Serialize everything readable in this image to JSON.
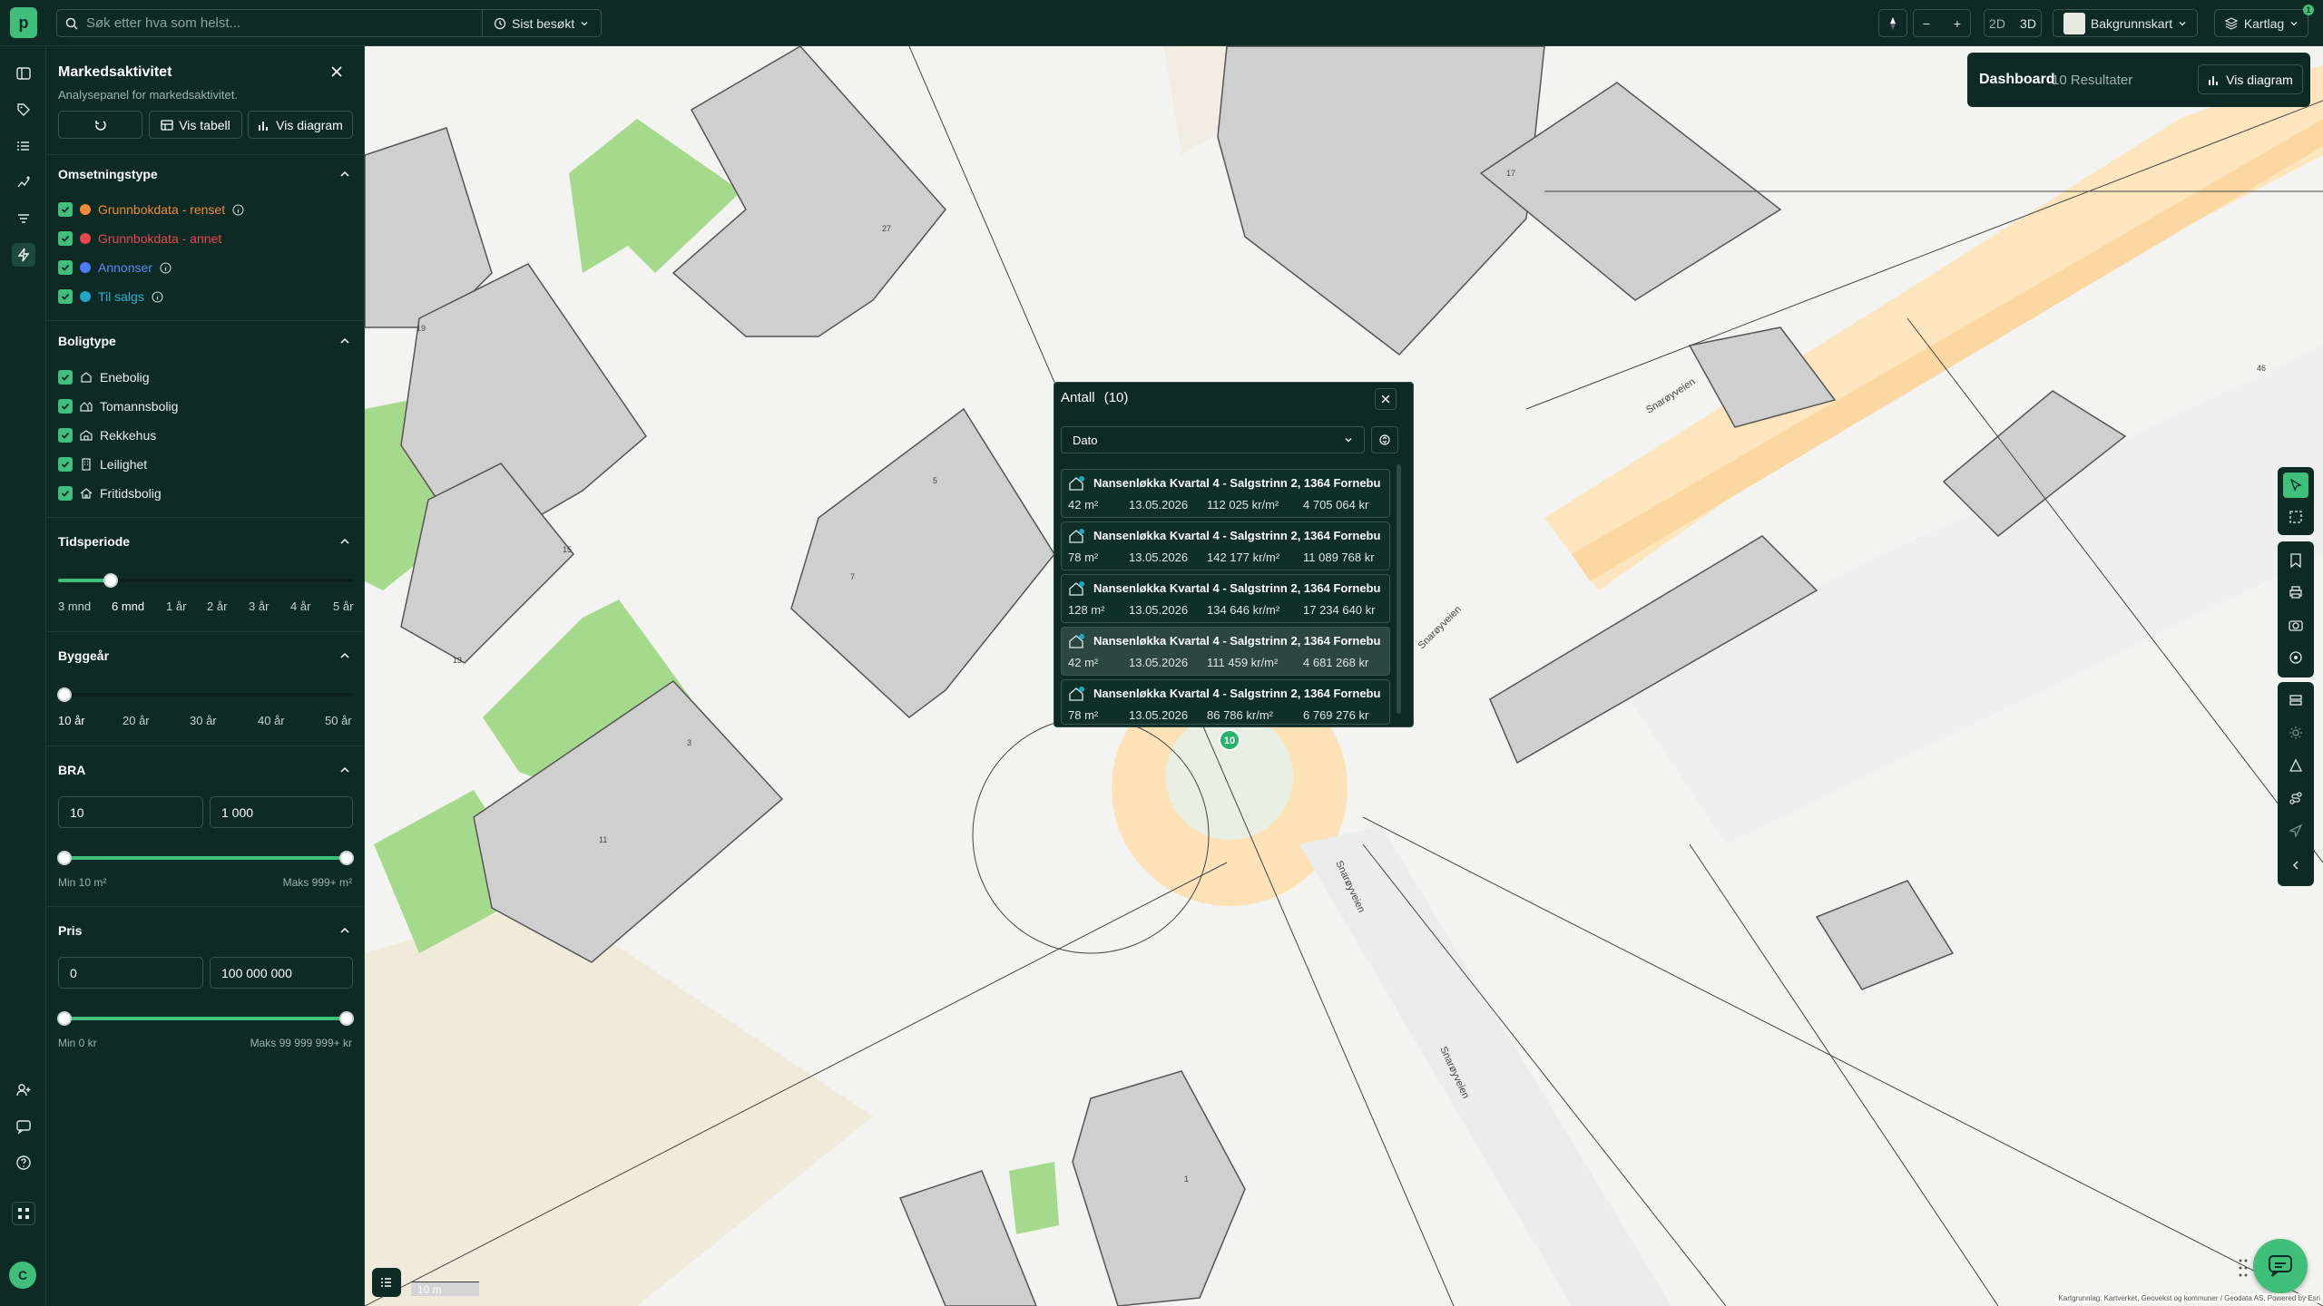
{
  "topbar": {
    "logo_letter": "p",
    "search_placeholder": "Søk etter hva som helst...",
    "recent_label": "Sist besøkt",
    "view_2d": "2D",
    "view_3d": "3D",
    "basemap_label": "Bakgrunnskart",
    "layers_label": "Kartlag",
    "layers_badge": "1"
  },
  "rail": {
    "avatar_letter": "C"
  },
  "panel": {
    "title": "Markedsaktivitet",
    "subtitle": "Analysepanel for markedsaktivitet.",
    "table_button": "Vis tabell",
    "chart_button": "Vis diagram",
    "transaction_type": {
      "title": "Omsetningstype",
      "items": [
        {
          "label": "Grunnbokdata - renset",
          "color": "#f08a3c",
          "checked": true,
          "info": true
        },
        {
          "label": "Grunnbokdata - annet",
          "color": "#e5484d",
          "checked": true,
          "info": false
        },
        {
          "label": "Annonser",
          "color": "#4f7cf0",
          "checked": true,
          "info": true
        },
        {
          "label": "Til salgs",
          "color": "#1fa6c9",
          "checked": true,
          "info": true
        }
      ]
    },
    "housing_type": {
      "title": "Boligtype",
      "items": [
        {
          "label": "Enebolig",
          "checked": true
        },
        {
          "label": "Tomannsbolig",
          "checked": true
        },
        {
          "label": "Rekkehus",
          "checked": true
        },
        {
          "label": "Leilighet",
          "checked": true
        },
        {
          "label": "Fritidsbolig",
          "checked": true
        }
      ]
    },
    "period": {
      "title": "Tidsperiode",
      "ticks": [
        "3 mnd",
        "6 mnd",
        "1 år",
        "2 år",
        "3 år",
        "4 år",
        "5 år"
      ],
      "selected": "6 mnd"
    },
    "build_year": {
      "title": "Byggeår",
      "ticks": [
        "10 år",
        "20 år",
        "30 år",
        "40 år",
        "50 år"
      ],
      "selected": "10 år"
    },
    "bra": {
      "title": "BRA",
      "min_value": "10",
      "max_value": "1 000",
      "min_label": "Min 10 m²",
      "max_label": "Maks 999+ m²"
    },
    "price": {
      "title": "Pris",
      "min_value": "0",
      "max_value": "100 000 000",
      "min_label": "Min 0 kr",
      "max_label": "Maks 99 999 999+ kr"
    }
  },
  "popup": {
    "title": "Antall",
    "count": "(10)",
    "sort_label": "Dato",
    "rows": [
      {
        "title": "Nansenløkka Kvartal 4 - Salgstrinn 2, 1364 Fornebu",
        "area": "42 m²",
        "date": "13.05.2026",
        "sqm_price": "112 025 kr/m²",
        "price": "4 705 064 kr"
      },
      {
        "title": "Nansenløkka Kvartal 4 - Salgstrinn 2, 1364 Fornebu",
        "area": "78 m²",
        "date": "13.05.2026",
        "sqm_price": "142 177 kr/m²",
        "price": "11 089 768 kr"
      },
      {
        "title": "Nansenløkka Kvartal 4 - Salgstrinn 2, 1364 Fornebu",
        "area": "128 m²",
        "date": "13.05.2026",
        "sqm_price": "134 646 kr/m²",
        "price": "17 234 640 kr"
      },
      {
        "title": "Nansenløkka Kvartal 4 - Salgstrinn 2, 1364 Fornebu",
        "area": "42 m²",
        "date": "13.05.2026",
        "sqm_price": "111 459 kr/m²",
        "price": "4 681 268 kr"
      },
      {
        "title": "Nansenløkka Kvartal 4 - Salgstrinn 2, 1364 Fornebu",
        "area": "78 m²",
        "date": "13.05.2026",
        "sqm_price": "86 786 kr/m²",
        "price": "6 769 276 kr"
      }
    ]
  },
  "dashboard": {
    "title": "Dashboard",
    "results": "10 Resultater",
    "chart_button": "Vis diagram"
  },
  "map": {
    "cluster_count": "10",
    "street_name": "Snarøyveien",
    "building_numbers": [
      "17",
      "27",
      "19",
      "15",
      "13",
      "5",
      "7",
      "3",
      "11",
      "1",
      "46"
    ],
    "scale_label": "10 m",
    "attribution": "Kartgrunnlag: Kartverket, Geovekst og kommuner / Geodata AS, Powered by Esri"
  }
}
